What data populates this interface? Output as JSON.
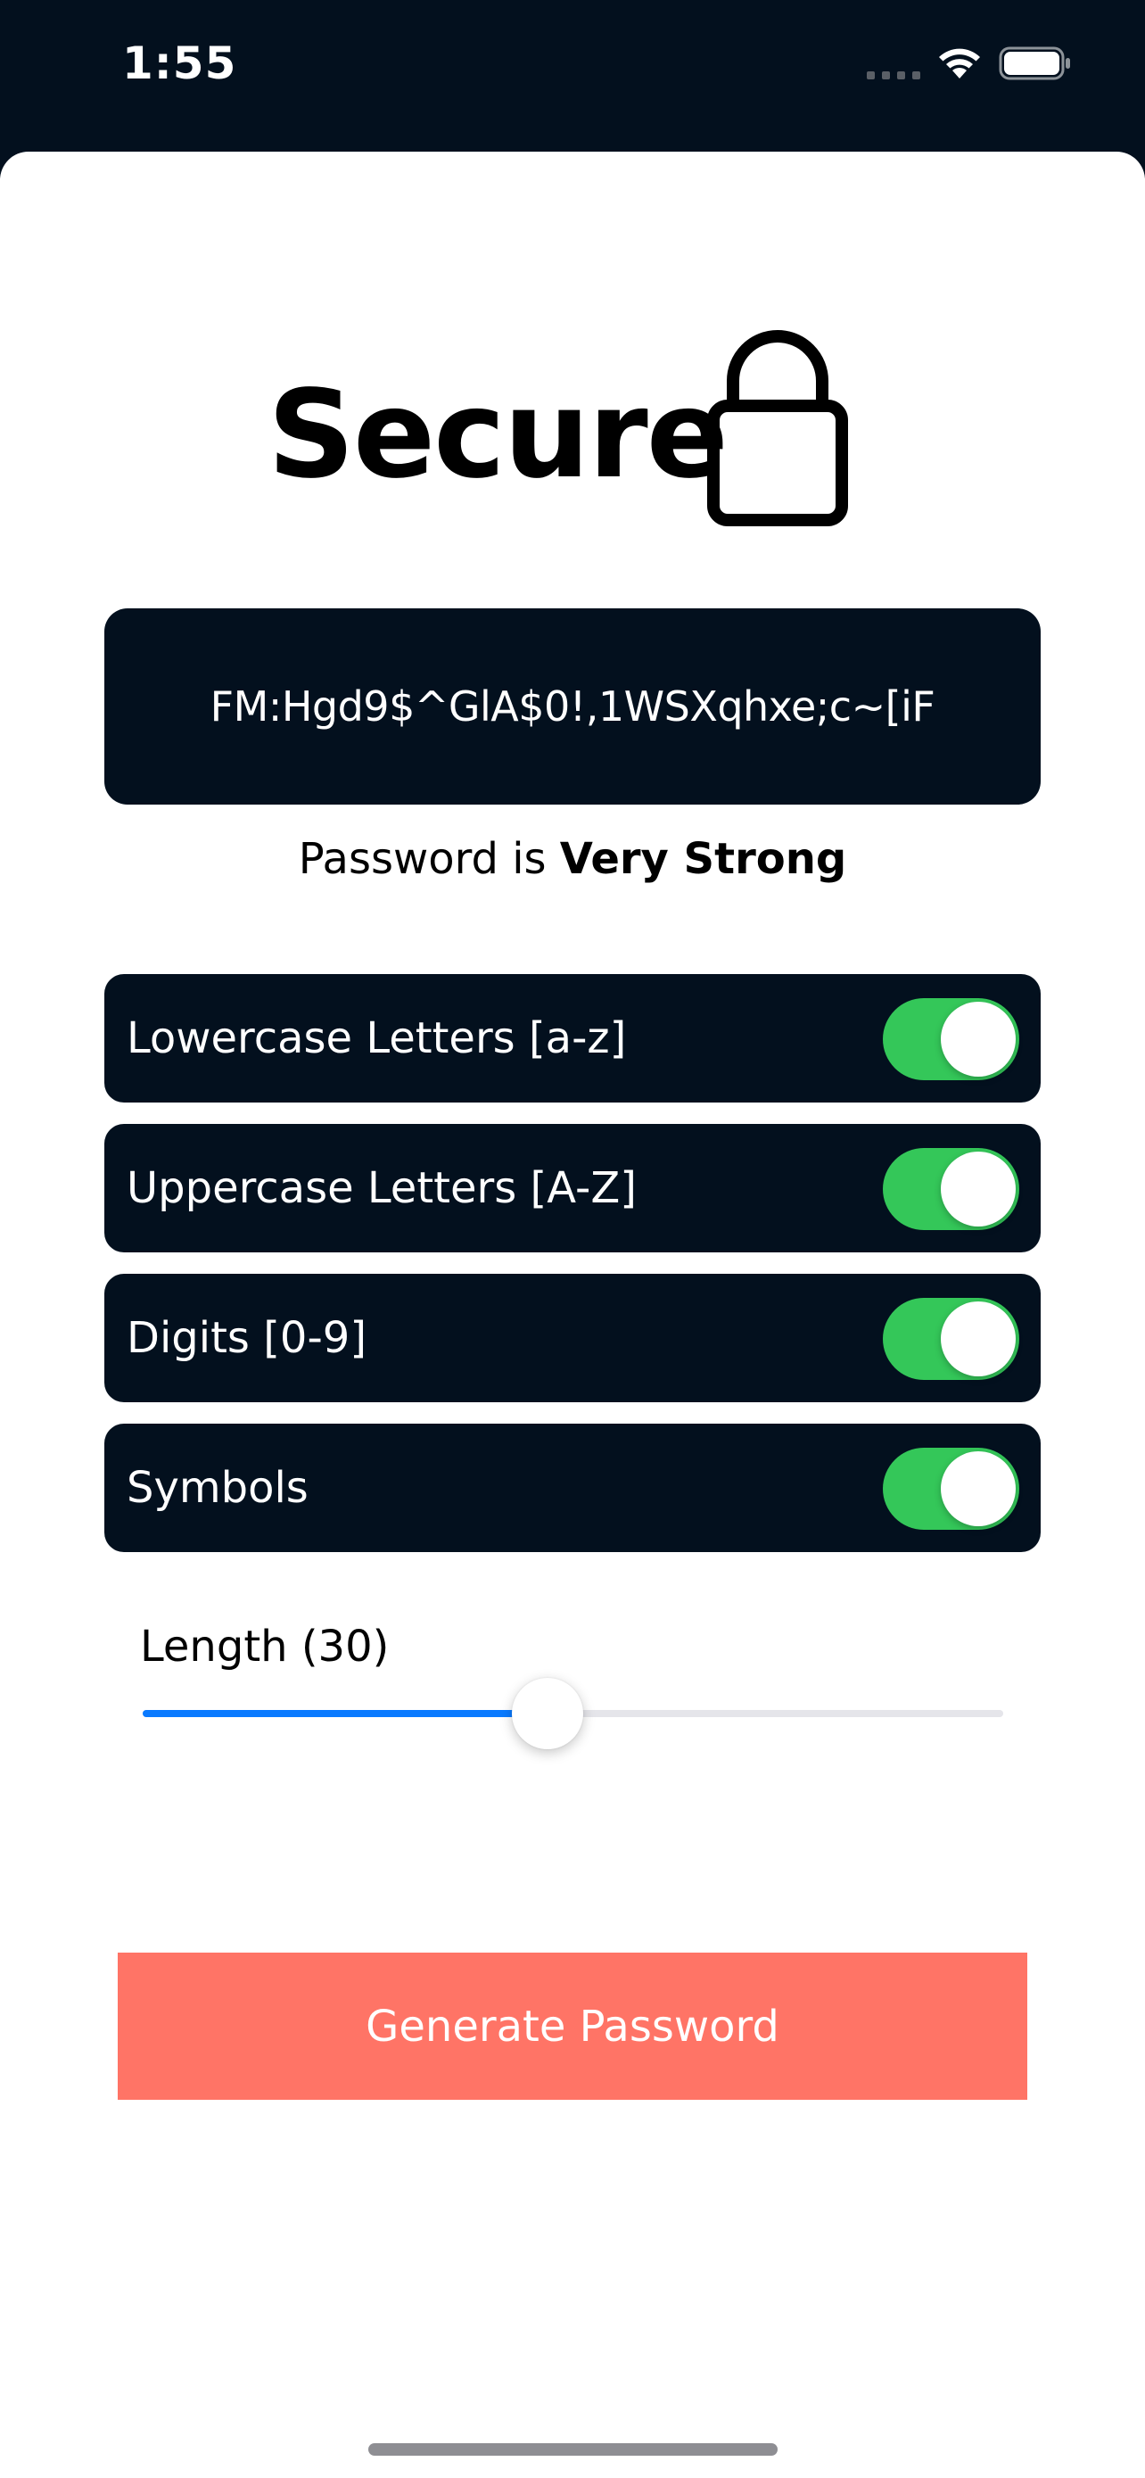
{
  "status_bar": {
    "time": "1:55",
    "icons": [
      "signal-dots-icon",
      "wifi-icon",
      "battery-icon"
    ]
  },
  "header": {
    "title": "Secure",
    "icon": "lock-icon"
  },
  "password": {
    "value": "FM:Hgd9$^GlA$0!,1WSXqhxe;c~[iF"
  },
  "strength": {
    "prefix": "Password is ",
    "level": "Very Strong"
  },
  "options": [
    {
      "label": "Lowercase Letters [a-z]",
      "enabled": true
    },
    {
      "label": "Uppercase Letters [A-Z]",
      "enabled": true
    },
    {
      "label": "Digits [0-9]",
      "enabled": true
    },
    {
      "label": "Symbols",
      "enabled": true
    }
  ],
  "length": {
    "label": "Length (30)",
    "value": 30,
    "fraction": 0.47
  },
  "generate_button": {
    "label": "Generate Password"
  },
  "colors": {
    "dark_navy": "#03101e",
    "toggle_on": "#34c759",
    "slider_fill": "#0a7aff",
    "button": "#ff7466"
  }
}
